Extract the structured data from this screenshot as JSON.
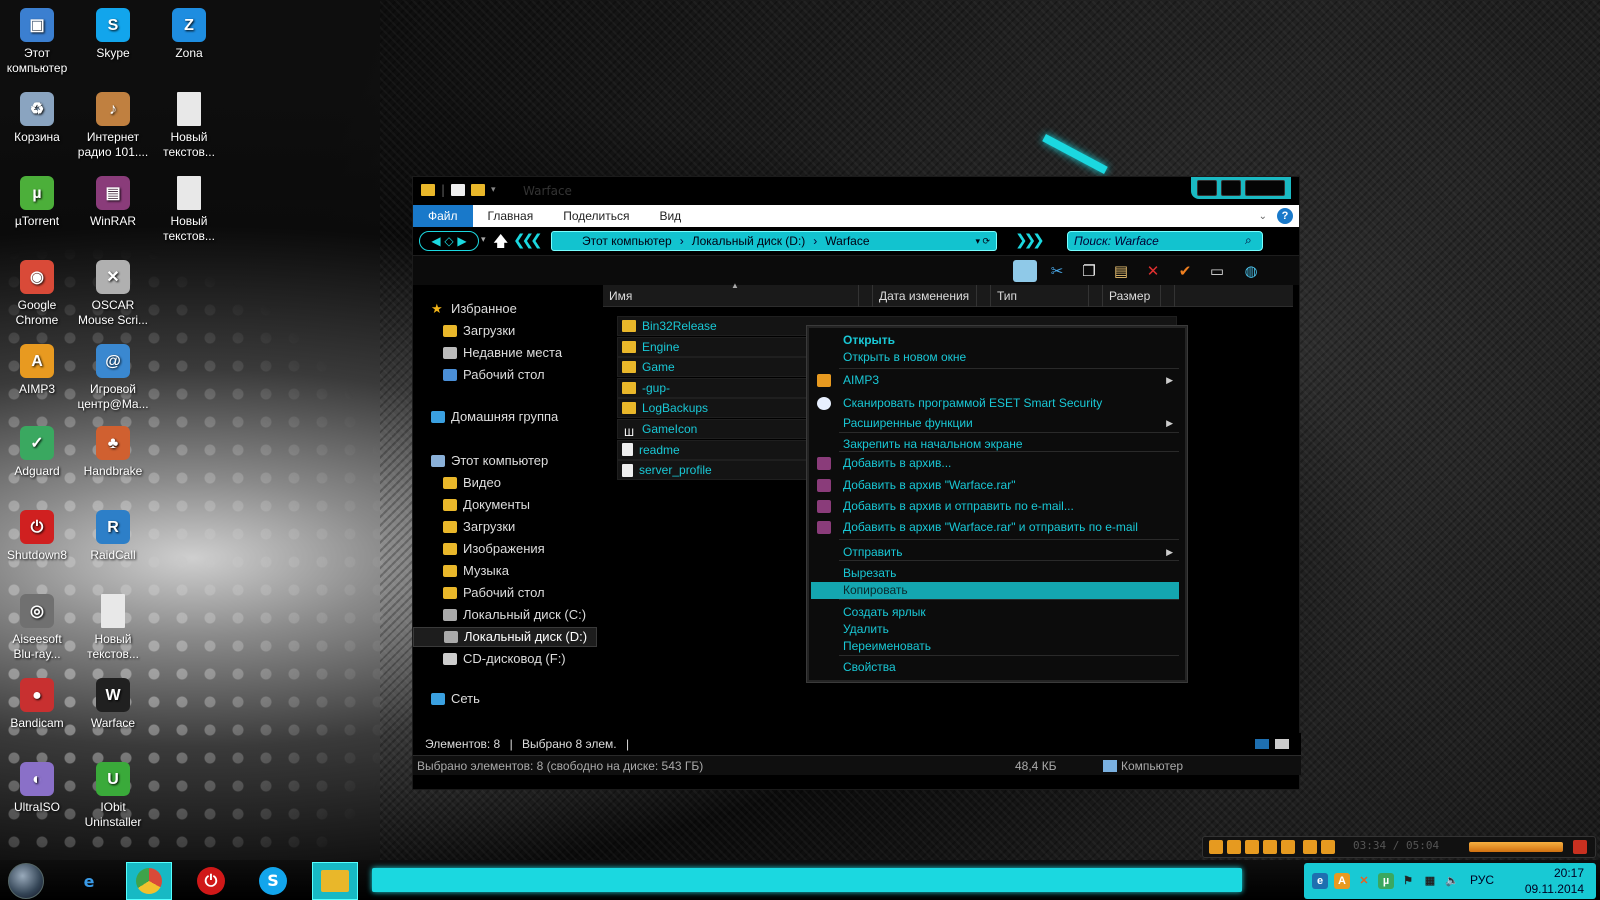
{
  "desktop_icons": [
    {
      "label": "Этот компьютер",
      "icon": "computer-icon",
      "color": "#3b7fd0"
    },
    {
      "label": "Skype",
      "icon": "skype-icon",
      "color": "#12a5ec"
    },
    {
      "label": "Zona",
      "icon": "zona-icon",
      "color": "#1e8de0"
    },
    {
      "label": "Корзина",
      "icon": "recycle-bin-icon",
      "color": "#8aa4c0"
    },
    {
      "label": "Интернет радио 101....",
      "icon": "radio-icon",
      "color": "#c08040"
    },
    {
      "label": "Новый текстов...",
      "icon": "text-file-icon",
      "color": "#e8e8e8"
    },
    {
      "label": "µTorrent",
      "icon": "utorrent-icon",
      "color": "#4caf3a"
    },
    {
      "label": "WinRAR",
      "icon": "winrar-icon",
      "color": "#8a3c7a"
    },
    {
      "label": "Новый текстов...",
      "icon": "text-file-icon",
      "color": "#e8e8e8"
    },
    {
      "label": "Google Chrome",
      "icon": "chrome-icon",
      "color": "#d94a38"
    },
    {
      "label": "OSCAR Mouse Scri...",
      "icon": "oscar-icon",
      "color": "#b0b0b0"
    },
    {
      "label": "AIMP3",
      "icon": "aimp-icon",
      "color": "#e89a20"
    },
    {
      "label": "Игровой центр@Ma...",
      "icon": "game-center-icon",
      "color": "#3a88d0"
    },
    {
      "label": "Adguard",
      "icon": "adguard-icon",
      "color": "#3aa860"
    },
    {
      "label": "Handbrake",
      "icon": "handbrake-icon",
      "color": "#d06030"
    },
    {
      "label": "Shutdown8",
      "icon": "shutdown-icon",
      "color": "#d02020"
    },
    {
      "label": "RaidCall",
      "icon": "raidcall-icon",
      "color": "#2d7fc8"
    },
    {
      "label": "Aiseesoft Blu-ray...",
      "icon": "aiseesoft-icon",
      "color": "#707070"
    },
    {
      "label": "Новый текстов...",
      "icon": "text-file-icon",
      "color": "#e8e8e8"
    },
    {
      "label": "Bandicam",
      "icon": "bandicam-icon",
      "color": "#c83030"
    },
    {
      "label": "Warface",
      "icon": "warface-icon",
      "color": "#202020"
    },
    {
      "label": "UltraISO",
      "icon": "ultraiso-icon",
      "color": "#8a70c8"
    },
    {
      "label": "IObit Uninstaller",
      "icon": "iobit-icon",
      "color": "#3aaa3a"
    }
  ],
  "window": {
    "title": "Warface",
    "ribbon_tabs": [
      "Файл",
      "Главная",
      "Поделиться",
      "Вид"
    ],
    "address": {
      "parts": [
        "Этот компьютер",
        "Локальный диск (D:)",
        "Warface"
      ],
      "separator": "›"
    },
    "search_placeholder": "Поиск: Warface",
    "nav_pane": [
      {
        "label": "Избранное",
        "icon": "star-icon"
      },
      {
        "label": "Загрузки",
        "icon": "folder-icon"
      },
      {
        "label": "Недавние места",
        "icon": "recent-places-icon"
      },
      {
        "label": "Рабочий стол",
        "icon": "desktop-icon"
      },
      {
        "label": "Домашняя группа",
        "icon": "homegroup-icon"
      },
      {
        "label": "Этот компьютер",
        "icon": "computer-icon"
      },
      {
        "label": "Видео",
        "icon": "folder-icon"
      },
      {
        "label": "Документы",
        "icon": "folder-icon"
      },
      {
        "label": "Загрузки",
        "icon": "folder-icon"
      },
      {
        "label": "Изображения",
        "icon": "folder-icon"
      },
      {
        "label": "Музыка",
        "icon": "folder-icon"
      },
      {
        "label": "Рабочий стол",
        "icon": "folder-icon"
      },
      {
        "label": "Локальный диск (C:)",
        "icon": "drive-icon"
      },
      {
        "label": "Локальный диск (D:)",
        "icon": "drive-icon"
      },
      {
        "label": "CD-дисковод (F:)",
        "icon": "cd-drive-icon"
      },
      {
        "label": "Сеть",
        "icon": "network-icon"
      }
    ],
    "columns": [
      "Имя",
      "Дата изменения",
      "Тип",
      "Размер"
    ],
    "files": [
      {
        "name": "Bin32Release",
        "kind": "folder"
      },
      {
        "name": "Engine",
        "kind": "folder"
      },
      {
        "name": "Game",
        "kind": "folder"
      },
      {
        "name": "-gup-",
        "kind": "folder"
      },
      {
        "name": "LogBackups",
        "kind": "folder"
      },
      {
        "name": "GameIcon",
        "kind": "warface"
      },
      {
        "name": "readme",
        "kind": "doc"
      },
      {
        "name": "server_profile",
        "kind": "doc"
      }
    ],
    "status_inner": {
      "count": "Элементов: 8",
      "selected": "Выбрано 8 элем."
    },
    "status_bottom": {
      "left": "Выбрано элементов: 8 (свободно на диске: 543 ГБ)",
      "size": "48,4 КБ",
      "location": "Компьютер"
    }
  },
  "context_menu": {
    "items": [
      {
        "label": "Открыть",
        "bold": true
      },
      {
        "label": "Открыть в новом окне"
      },
      {
        "label": "AIMP3",
        "submenu": true,
        "icon": "aimp-icon"
      },
      {
        "label": "Сканировать программой ESET Smart Security",
        "icon": "eset-icon"
      },
      {
        "label": "Расширенные функции",
        "submenu": true
      },
      {
        "label": "Закрепить на начальном экране"
      },
      {
        "label": "Добавить в архив...",
        "icon": "winrar-icon"
      },
      {
        "label": "Добавить в архив \"Warface.rar\"",
        "icon": "winrar-icon"
      },
      {
        "label": "Добавить в архив и отправить по e-mail...",
        "icon": "winrar-icon"
      },
      {
        "label": "Добавить в архив \"Warface.rar\" и отправить по e-mail",
        "icon": "winrar-icon"
      },
      {
        "label": "Отправить",
        "submenu": true
      },
      {
        "label": "Вырезать"
      },
      {
        "label": "Копировать",
        "highlighted": true
      },
      {
        "label": "Создать ярлык"
      },
      {
        "label": "Удалить"
      },
      {
        "label": "Переименовать"
      },
      {
        "label": "Свойства"
      }
    ]
  },
  "player": {
    "time": "03:34 / 05:04"
  },
  "taskbar": {
    "apps": [
      {
        "icon": "internet-explorer-icon"
      },
      {
        "icon": "chrome-icon"
      },
      {
        "icon": "shutdown-icon"
      },
      {
        "icon": "skype-icon"
      },
      {
        "icon": "file-explorer-icon"
      }
    ],
    "tray": {
      "language": "РУС",
      "time": "20:17",
      "date": "09.11.2014"
    }
  },
  "colors": {
    "accent": "#1bd8e0",
    "selection": "#14a6b0",
    "file_text": "#19c8d6",
    "ribbon_file_tab": "#1979ca"
  }
}
